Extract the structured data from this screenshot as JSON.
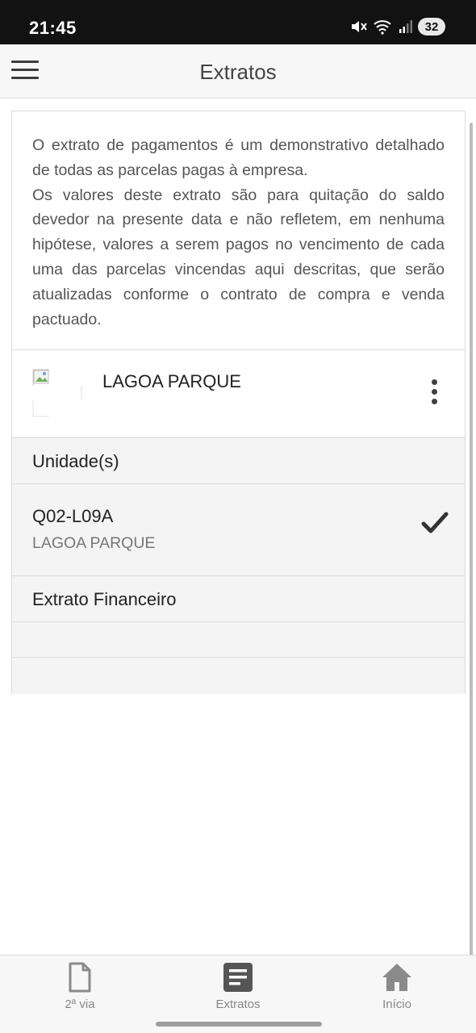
{
  "status_bar": {
    "time": "21:45",
    "battery": "32",
    "icons": [
      "mute-icon",
      "wifi-icon",
      "signal-icon"
    ]
  },
  "header": {
    "title": "Extratos",
    "menu_icon": "hamburger-menu-icon"
  },
  "info": {
    "paragraph_1": "O extrato de pagamentos é um demonstrativo detalhado de todas as parcelas pagas à empresa.",
    "paragraph_2": "Os valores deste extrato são para quitação do saldo devedor na presente data e não refletem, em nenhuma hipótese, valores a serem pagos no vencimento de cada uma das parcelas vincendas aqui descritas, que serão atualizadas conforme o contrato de compra e venda pactuado."
  },
  "enterprise": {
    "name": "LAGOA PARQUE",
    "logo_icon": "broken-image-icon",
    "more_icon": "more-vertical-icon"
  },
  "units_section": {
    "title": "Unidade(s)",
    "items": [
      {
        "code": "Q02-L09A",
        "name": "LAGOA PARQUE",
        "selected": true
      }
    ]
  },
  "financial_section": {
    "title": "Extrato Financeiro"
  },
  "bottom_nav": {
    "items": [
      {
        "label": "2ª via",
        "icon": "document-icon"
      },
      {
        "label": "Extratos",
        "icon": "list-document-icon"
      },
      {
        "label": "Início",
        "icon": "home-icon"
      }
    ]
  },
  "colors": {
    "status_bar": "#121212",
    "header_bg": "#f7f7f7",
    "row_bg": "#f4f4f4",
    "border": "#dcdcdc",
    "nav_icon": "#8a8a8a",
    "nav_icon_active": "#555555"
  }
}
